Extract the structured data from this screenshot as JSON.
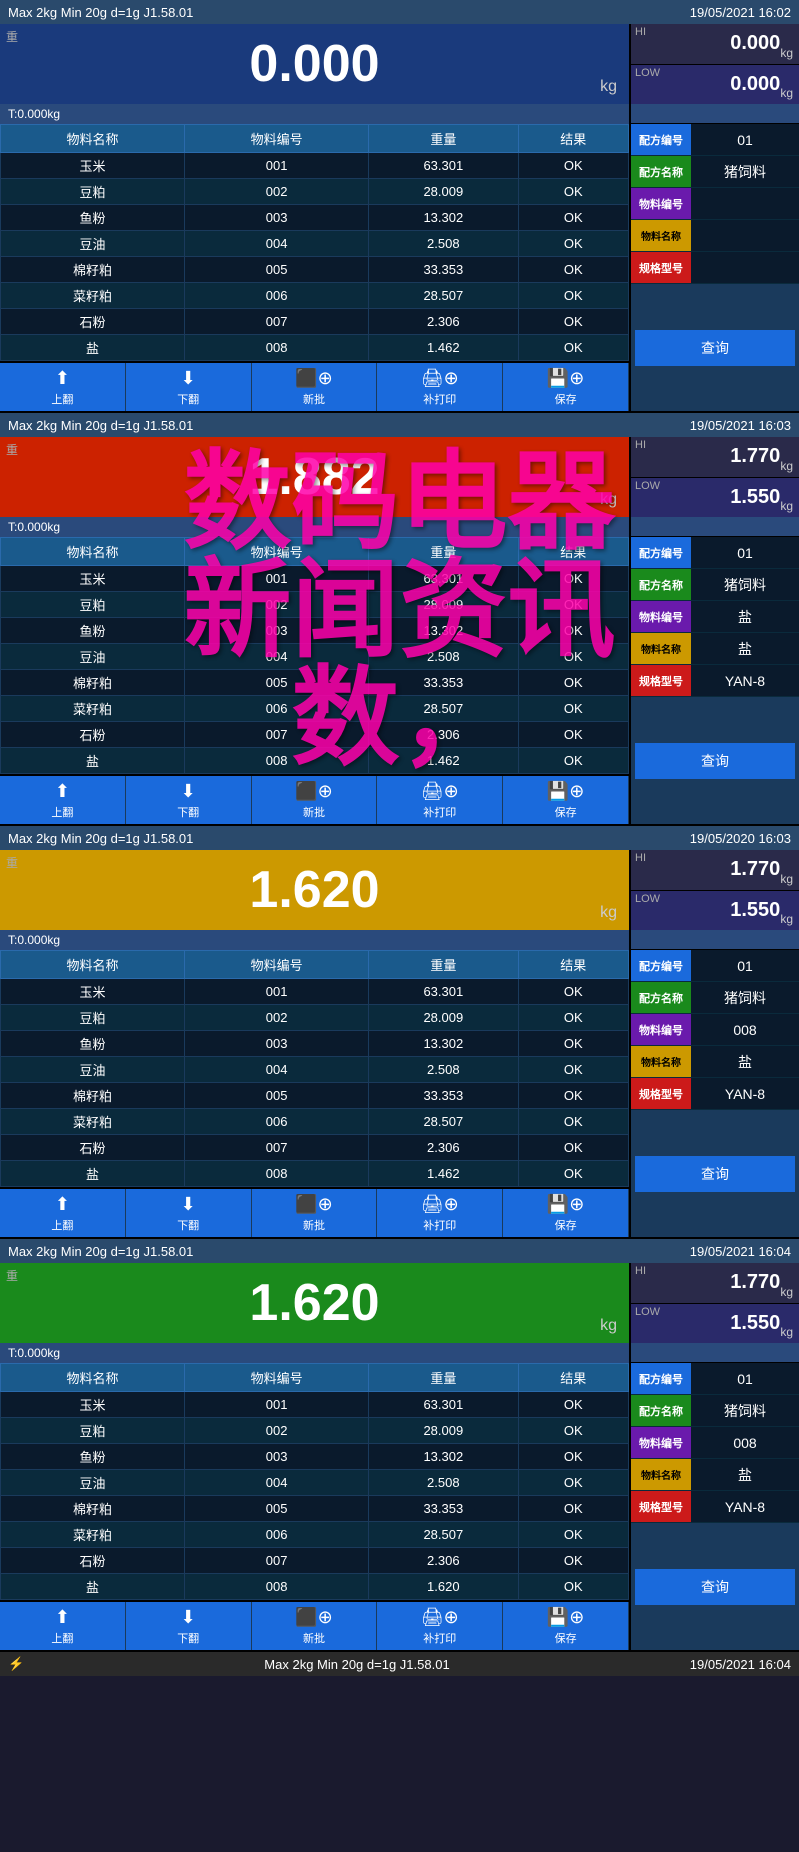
{
  "panels": [
    {
      "id": "panel1",
      "topbar": {
        "left": "Max 2kg  Min 20g  d=1g    J1.58.01",
        "right": "19/05/2021  16:02"
      },
      "weight": {
        "main": "0.000",
        "unit": "kg",
        "hi_label": "HI",
        "hi_value": "0.000",
        "hi_unit": "kg",
        "lo_label": "LOW",
        "lo_value": "0.000",
        "lo_unit": "kg",
        "net_label": "T:0.000kg",
        "bg": "zero"
      },
      "table": {
        "headers": [
          "物料名称",
          "物料编号",
          "重量",
          "结果"
        ],
        "rows": [
          [
            "玉米",
            "001",
            "63.301",
            "OK"
          ],
          [
            "豆粕",
            "002",
            "28.009",
            "OK"
          ],
          [
            "鱼粉",
            "003",
            "13.302",
            "OK"
          ],
          [
            "豆油",
            "004",
            "2.508",
            "OK"
          ],
          [
            "棉籽粕",
            "005",
            "33.353",
            "OK"
          ],
          [
            "菜籽粕",
            "006",
            "28.507",
            "OK"
          ],
          [
            "石粉",
            "007",
            "2.306",
            "OK"
          ],
          [
            "盐",
            "008",
            "1.462",
            "OK"
          ]
        ]
      },
      "info": {
        "recipe_no_label": "配方编号",
        "recipe_no_value": "01",
        "recipe_name_label": "配方名称",
        "recipe_name_value": "猪饲料",
        "material_no_label": "物料编号",
        "material_no_value": "",
        "material_name_label": "物料名称",
        "material_name_value": "",
        "spec_label": "规格型号",
        "spec_value": "",
        "query_label": "查询"
      },
      "buttons": {
        "up": "上翻",
        "down": "下翻",
        "new": "新批",
        "print": "补打印",
        "save": "保存"
      }
    },
    {
      "id": "panel2",
      "topbar": {
        "left": "Max 2kg  Min 20g  d=1g    J1.58.01",
        "right": "19/05/2021  16:03"
      },
      "weight": {
        "main": "1.882",
        "unit": "kg",
        "hi_label": "HI",
        "hi_value": "1.770",
        "hi_unit": "kg",
        "lo_label": "LOW",
        "lo_value": "1.550",
        "lo_unit": "kg",
        "net_label": "T:0.000kg",
        "bg": "red"
      },
      "table": {
        "headers": [
          "物料名称",
          "物料编号",
          "重量",
          "结果"
        ],
        "rows": [
          [
            "玉米",
            "001",
            "63.301",
            "OK"
          ],
          [
            "豆粕",
            "002",
            "28.009",
            "OK"
          ],
          [
            "鱼粉",
            "003",
            "13.302",
            "OK"
          ],
          [
            "豆油",
            "004",
            "2.508",
            "OK"
          ],
          [
            "棉籽粕",
            "005",
            "33.353",
            "OK"
          ],
          [
            "菜籽粕",
            "006",
            "28.507",
            "OK"
          ],
          [
            "石粉",
            "007",
            "2.306",
            "OK"
          ],
          [
            "盐",
            "008",
            "1.462",
            "OK"
          ]
        ]
      },
      "info": {
        "recipe_no_label": "配方编号",
        "recipe_no_value": "01",
        "recipe_name_label": "配方名称",
        "recipe_name_value": "猪饲料",
        "material_no_label": "物料编号",
        "material_no_value": "盐",
        "material_name_label": "物料名称",
        "material_name_value": "盐",
        "spec_label": "规格型号",
        "spec_value": "YAN-8",
        "query_label": "查询"
      },
      "buttons": {
        "up": "上翻",
        "down": "下翻",
        "new": "新批",
        "print": "补打印",
        "save": "保存"
      }
    },
    {
      "id": "panel3",
      "topbar": {
        "left": "Max 2kg  Min 20g  d=1g    J1.58.01",
        "right": "19/05/2020  16:03"
      },
      "weight": {
        "main": "1.620",
        "unit": "kg",
        "hi_label": "HI",
        "hi_value": "1.770",
        "hi_unit": "kg",
        "lo_label": "LOW",
        "lo_value": "1.550",
        "lo_unit": "kg",
        "net_label": "T:0.000kg",
        "bg": "yellow"
      },
      "table": {
        "headers": [
          "物料名称",
          "物料编号",
          "重量",
          "结果"
        ],
        "rows": [
          [
            "玉米",
            "001",
            "63.301",
            "OK"
          ],
          [
            "豆粕",
            "002",
            "28.009",
            "OK"
          ],
          [
            "鱼粉",
            "003",
            "13.302",
            "OK"
          ],
          [
            "豆油",
            "004",
            "2.508",
            "OK"
          ],
          [
            "棉籽粕",
            "005",
            "33.353",
            "OK"
          ],
          [
            "菜籽粕",
            "006",
            "28.507",
            "OK"
          ],
          [
            "石粉",
            "007",
            "2.306",
            "OK"
          ],
          [
            "盐",
            "008",
            "1.462",
            "OK"
          ]
        ]
      },
      "info": {
        "recipe_no_label": "配方编号",
        "recipe_no_value": "01",
        "recipe_name_label": "配方名称",
        "recipe_name_value": "猪饲料",
        "material_no_label": "物料编号",
        "material_no_value": "008",
        "material_name_label": "物料名称",
        "material_name_value": "盐",
        "spec_label": "规格型号",
        "spec_value": "YAN-8",
        "query_label": "查询"
      },
      "buttons": {
        "up": "上翻",
        "down": "下翻",
        "new": "新批",
        "print": "补打印",
        "save": "保存"
      }
    },
    {
      "id": "panel4",
      "topbar": {
        "left": "Max 2kg  Min 20g  d=1g    J1.58.01",
        "right": "19/05/2021  16:04"
      },
      "weight": {
        "main": "1.620",
        "unit": "kg",
        "hi_label": "HI",
        "hi_value": "1.770",
        "hi_unit": "kg",
        "lo_label": "LOW",
        "lo_value": "1.550",
        "lo_unit": "kg",
        "net_label": "T:0.000kg",
        "bg": "green"
      },
      "table": {
        "headers": [
          "物料名称",
          "物料编号",
          "重量",
          "结果"
        ],
        "rows": [
          [
            "玉米",
            "001",
            "63.301",
            "OK"
          ],
          [
            "豆粕",
            "002",
            "28.009",
            "OK"
          ],
          [
            "鱼粉",
            "003",
            "13.302",
            "OK"
          ],
          [
            "豆油",
            "004",
            "2.508",
            "OK"
          ],
          [
            "棉籽粕",
            "005",
            "33.353",
            "OK"
          ],
          [
            "菜籽粕",
            "006",
            "28.507",
            "OK"
          ],
          [
            "石粉",
            "007",
            "2.306",
            "OK"
          ],
          [
            "盐",
            "008",
            "1.620",
            "OK"
          ]
        ]
      },
      "info": {
        "recipe_no_label": "配方编号",
        "recipe_no_value": "01",
        "recipe_name_label": "配方名称",
        "recipe_name_value": "猪饲料",
        "material_no_label": "物料编号",
        "material_no_value": "008",
        "material_name_label": "物料名称",
        "material_name_value": "盐",
        "spec_label": "规格型号",
        "spec_value": "YAN-8",
        "query_label": "查询"
      },
      "buttons": {
        "up": "上翻",
        "down": "下翻",
        "new": "新批",
        "print": "补打印",
        "save": "保存"
      }
    }
  ],
  "bottom_bar": {
    "left": "⚡",
    "center": "Max 2kg  Min 20g  d=1g    J1.58.01",
    "right": "19/05/2021  16:04"
  },
  "watermark": {
    "line1": "数码电器",
    "line2": "新闻资讯",
    "line3": "数，"
  }
}
